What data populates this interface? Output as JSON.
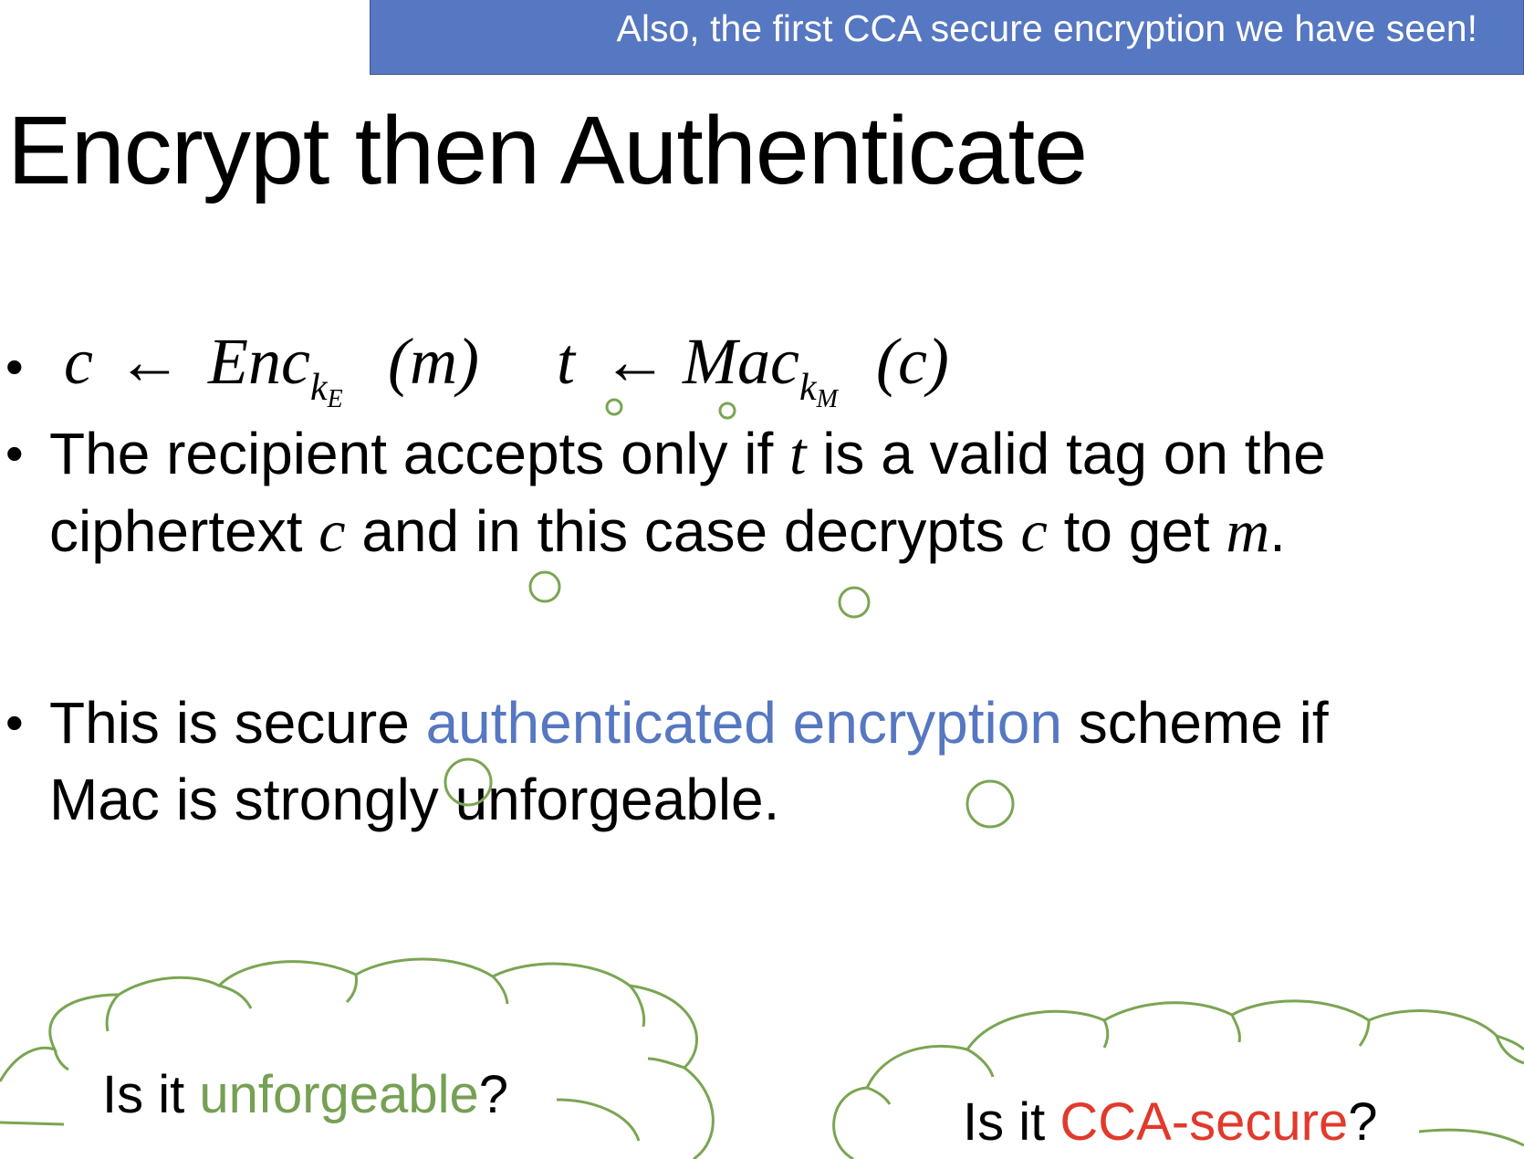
{
  "banner": {
    "text": "Also, the first CCA secure encryption we have seen!"
  },
  "title": "Encrypt then Authenticate",
  "formula": {
    "c1": "c",
    "arrow1": "←",
    "enc": "Enc",
    "k1": "k",
    "k1_sub": "E",
    "m_paren": "(m)",
    "t": "t",
    "arrow2": "←",
    "mac": "Mac",
    "k2": "k",
    "k2_sub": "M",
    "c_paren": "(c)"
  },
  "bullet2": {
    "part1": "The recipient accepts only if ",
    "var_t": "t",
    "part2": " is a valid tag on the",
    "part3": "ciphertext ",
    "var_c1": "c",
    "part4": " and in this case decrypts ",
    "var_c2": "c",
    "part5": "  to get ",
    "var_m": "m",
    "part6": "."
  },
  "bullet3": {
    "part1": "This is secure ",
    "highlight": "authenticated  encryption",
    "part2": " scheme if",
    "part3": "Mac is strongly unforgeable."
  },
  "cloud_left": {
    "prefix": "Is it ",
    "highlight": "unforgeable",
    "suffix": "?"
  },
  "cloud_right": {
    "prefix": "Is it ",
    "highlight": "CCA-secure",
    "suffix": "?"
  },
  "colors": {
    "banner": "#5677c1",
    "blue_text": "#5677c1",
    "green_text": "#76a054",
    "red_text": "#e13a2c",
    "cloud_outline": "#7aa552"
  }
}
